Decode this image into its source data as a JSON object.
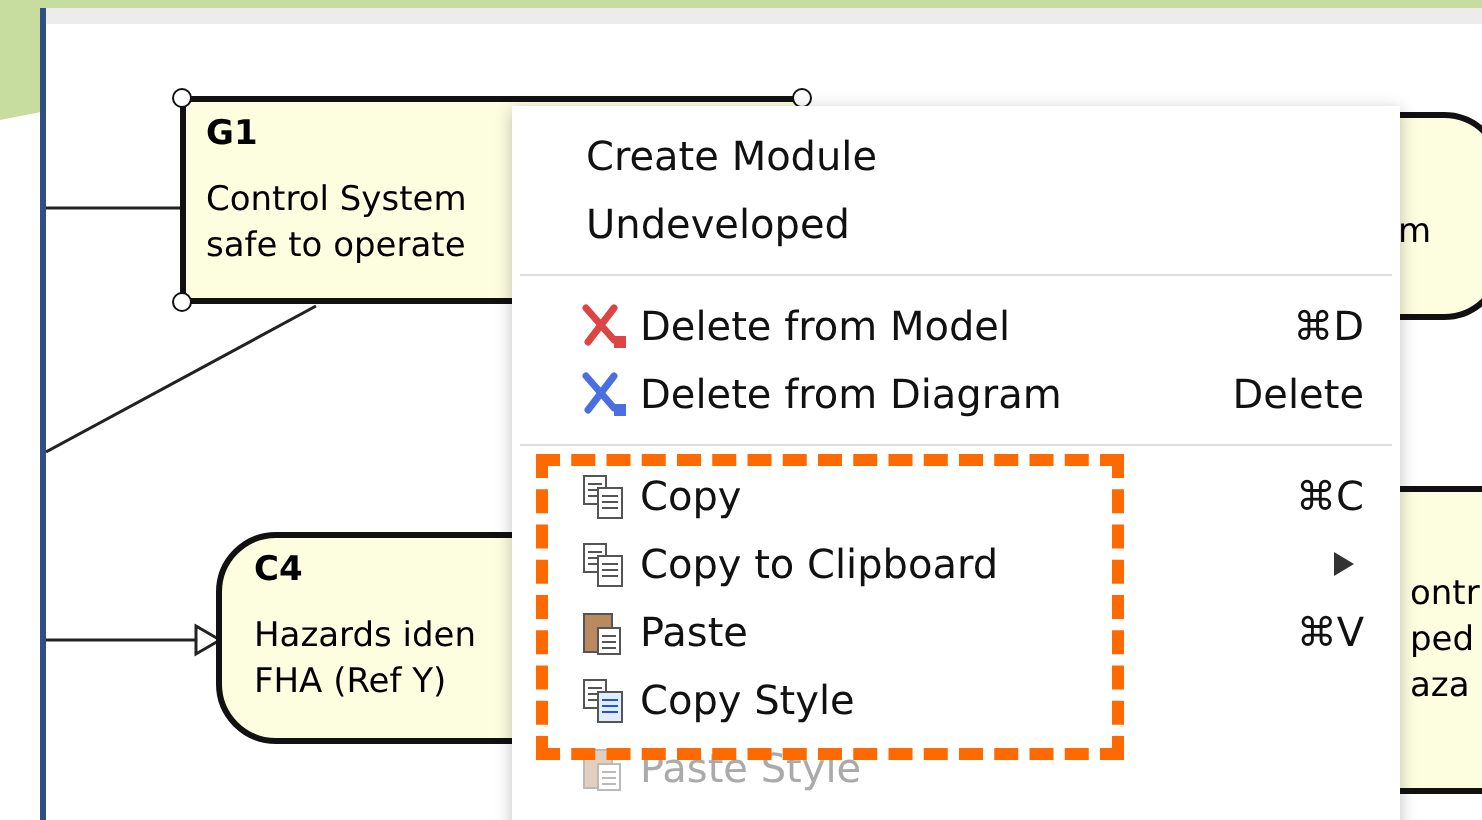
{
  "diagram": {
    "nodes": [
      {
        "kind": "goal",
        "id_label": "G1",
        "lines": [
          "Control System",
          "safe to operate"
        ]
      },
      {
        "kind": "context",
        "id_label": "C4",
        "lines": [
          "Hazards iden",
          "FHA (Ref Y)"
        ]
      },
      {
        "kind": "context-right",
        "lines": [
          "m"
        ]
      },
      {
        "kind": "goal-right",
        "lines": [
          "ontr",
          "ped",
          "aza"
        ]
      }
    ]
  },
  "context_menu": {
    "groups": [
      [
        {
          "label": "Create Module",
          "submenu": false,
          "disabled": false
        },
        {
          "label": "Undeveloped",
          "submenu": false,
          "disabled": false
        }
      ],
      [
        {
          "label": "Delete from Model",
          "shortcut": "⌘D",
          "submenu": false,
          "disabled": false
        },
        {
          "label": "Delete from Diagram",
          "shortcut": "Delete",
          "submenu": false,
          "disabled": false
        }
      ],
      [
        {
          "label": "Copy",
          "shortcut": "⌘C",
          "submenu": false,
          "disabled": false
        },
        {
          "label": "Copy to Clipboard",
          "submenu": true,
          "disabled": false
        },
        {
          "label": "Paste",
          "shortcut": "⌘V",
          "submenu": false,
          "disabled": false
        },
        {
          "label": "Copy Style",
          "submenu": false,
          "disabled": false
        },
        {
          "label": "Paste Style",
          "submenu": false,
          "disabled": true
        }
      ]
    ]
  }
}
